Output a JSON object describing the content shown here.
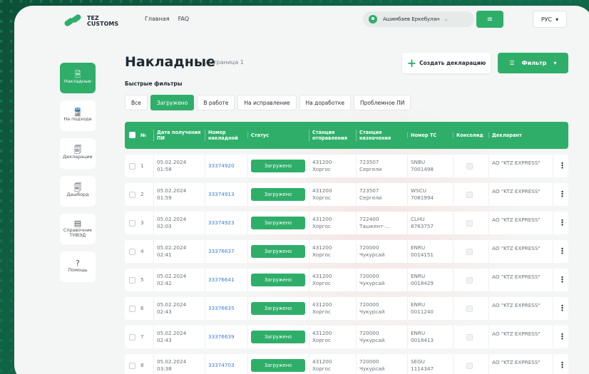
{
  "logo": {
    "line1": "TEZ",
    "line2": "CUSTOMS"
  },
  "nav": [
    "Главная",
    "FAQ"
  ],
  "user": {
    "name": "Ашимбаев Еркебулан"
  },
  "menu_icon": "hamburger-icon",
  "lang": {
    "label": "РУС"
  },
  "sidebar": {
    "items": [
      {
        "label": "Накладные",
        "icon": "document-icon",
        "glyph": "🗎",
        "active": true
      },
      {
        "label": "На подходе",
        "icon": "train-icon",
        "glyph": "🚆",
        "active": false
      },
      {
        "label": "Декларации",
        "icon": "declaration-icon",
        "glyph": "🗐",
        "active": false
      },
      {
        "label": "Дашборд",
        "icon": "dashboard-icon",
        "glyph": "🗐",
        "active": false
      },
      {
        "label": "Справочник ТНВЭД",
        "icon": "book-icon",
        "glyph": "▤",
        "active": false
      },
      {
        "label": "Помощь",
        "icon": "help-icon",
        "glyph": "?",
        "active": false
      }
    ]
  },
  "page": {
    "title": "Накладные",
    "subtitle": "/ Страница 1"
  },
  "actions": {
    "create_label": "Создать декларацию",
    "filter_label": "Фильтр"
  },
  "quick_filters": {
    "label": "Быстрые фильтры",
    "chips": [
      {
        "label": "Все",
        "active": false
      },
      {
        "label": "Загружено",
        "active": true
      },
      {
        "label": "В работе",
        "active": false
      },
      {
        "label": "На исправление",
        "active": false
      },
      {
        "label": "На доработке",
        "active": false
      },
      {
        "label": "Проблемное ПИ",
        "active": false
      }
    ]
  },
  "table": {
    "headers": {
      "num": "№",
      "date": "Дата получения ПИ",
      "invoice": "Номер накладной",
      "status": "Статус",
      "from": "Станция отправления",
      "to": "Станция назначения",
      "tc": "Номер ТС",
      "consol": "Консолид",
      "declarant": "Декларант"
    },
    "rows": [
      {
        "num": "1",
        "date": "05.02.2024",
        "time": "01:58",
        "invoice": "33374920",
        "status": "Загружено",
        "from_code": "431200",
        "from_name": "Хоргос",
        "to_code": "723507",
        "to_name": "Сергели",
        "tc1": "SNBU",
        "tc2": "7001498",
        "declarant": "АО \"KTZ EXPRESS\""
      },
      {
        "num": "2",
        "date": "05.02.2024",
        "time": "01:59",
        "invoice": "33374913",
        "status": "Загружено",
        "from_code": "431200",
        "from_name": "Хоргос",
        "to_code": "723507",
        "to_name": "Сергели",
        "tc1": "WSCU",
        "tc2": "7081994",
        "declarant": "АО \"KTZ EXPRESS\""
      },
      {
        "num": "3",
        "date": "05.02.2024",
        "time": "02:03",
        "invoice": "33374923",
        "status": "Загружено",
        "from_code": "431200",
        "from_name": "Хоргос",
        "to_code": "722400",
        "to_name": "Ташкент-...",
        "tc1": "CLHU",
        "tc2": "8763757",
        "declarant": "АО \"KTZ EXPRESS\""
      },
      {
        "num": "4",
        "date": "05.02.2024",
        "time": "02:41",
        "invoice": "33376637",
        "status": "Загружено",
        "from_code": "431200",
        "from_name": "Хоргос",
        "to_code": "720000",
        "to_name": "Чукурсай",
        "tc1": "ENRU",
        "tc2": "0014151",
        "declarant": "АО \"KTZ EXPRESS\""
      },
      {
        "num": "5",
        "date": "05.02.2024",
        "time": "02:42",
        "invoice": "33376641",
        "status": "Загружено",
        "from_code": "431200",
        "from_name": "Хоргос",
        "to_code": "720000",
        "to_name": "Чукурсай",
        "tc1": "ENRU",
        "tc2": "0018429",
        "declarant": "АО \"KTZ EXPRESS\""
      },
      {
        "num": "6",
        "date": "05.02.2024",
        "time": "02:43",
        "invoice": "33376635",
        "status": "Загружено",
        "from_code": "431200",
        "from_name": "Хоргос",
        "to_code": "720000",
        "to_name": "Чукурсай",
        "tc1": "ENRU",
        "tc2": "0011240",
        "declarant": "АО \"KTZ EXPRESS\""
      },
      {
        "num": "7",
        "date": "05.02.2024",
        "time": "02:43",
        "invoice": "33376639",
        "status": "Загружено",
        "from_code": "431200",
        "from_name": "Хоргос",
        "to_code": "720000",
        "to_name": "Чукурсай",
        "tc1": "ENRU",
        "tc2": "0018413",
        "declarant": "АО \"KTZ EXPRESS\""
      },
      {
        "num": "8",
        "date": "05.02.2024",
        "time": "03:38",
        "invoice": "33374703",
        "status": "Загружено",
        "from_code": "431200",
        "from_name": "Хоргос",
        "to_code": "720000",
        "to_name": "Чукурсай",
        "tc1": "SEGU",
        "tc2": "1114347",
        "declarant": "АО \"KTZ EXPRESS\""
      }
    ]
  },
  "colors": {
    "accent": "#2fae6a",
    "link": "#3b7dd8",
    "background": "#0f5a3f"
  }
}
